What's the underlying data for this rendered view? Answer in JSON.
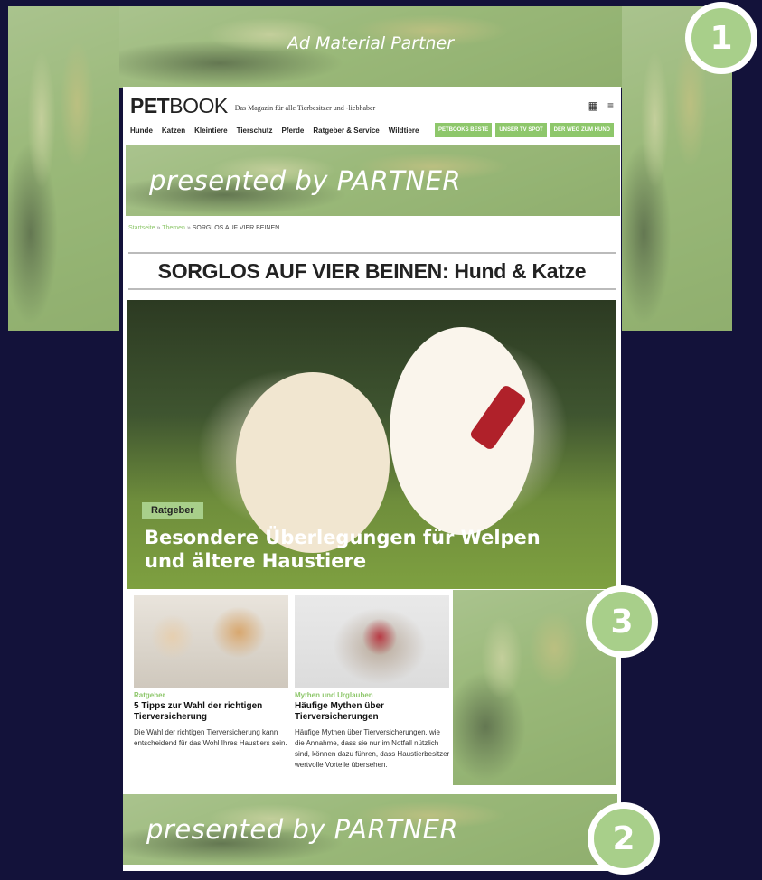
{
  "top_banner": {
    "text": "Ad Material Partner"
  },
  "badges": [
    "1",
    "3",
    "2"
  ],
  "header": {
    "logo_bold": "PET",
    "logo_light": "BOOK",
    "tagline": "Das Magazin für alle Tierbesitzer und -liebhaber",
    "nav": [
      "Hunde",
      "Katzen",
      "Kleintiere",
      "Tierschutz",
      "Pferde",
      "Ratgeber & Service",
      "Wildtiere"
    ],
    "nav_buttons": [
      "PETBOOKS BESTE",
      "UNSER TV SPOT",
      "DER WEG ZUM HUND"
    ]
  },
  "partner_banner": {
    "text": "presented by PARTNER"
  },
  "breadcrumb": {
    "home": "Startseite",
    "sep": " » ",
    "themen": "Themen",
    "current": "SORGLOS AUF VIER BEINEN"
  },
  "page_title": "SORGLOS AUF VIER BEINEN: Hund & Katze",
  "hero": {
    "tag": "Ratgeber",
    "title": "Besondere Überlegungen für Welpen und ältere Haustiere"
  },
  "cards": [
    {
      "category": "Ratgeber",
      "title": "5 Tipps zur Wahl der richtigen Tierversicherung",
      "text": "Die Wahl der richtigen Tierversicherung kann entscheidend für das Wohl Ihres Haustiers sein."
    },
    {
      "category": "Mythen und Urglauben",
      "title": "Häufige Mythen über Tierversicherungen",
      "text": "Häufige Mythen über Tierversicherungen, wie die Annahme, dass sie nur im Notfall nützlich sind, können dazu führen, dass Haustierbesitzer wertvolle Vorteile übersehen."
    }
  ]
}
